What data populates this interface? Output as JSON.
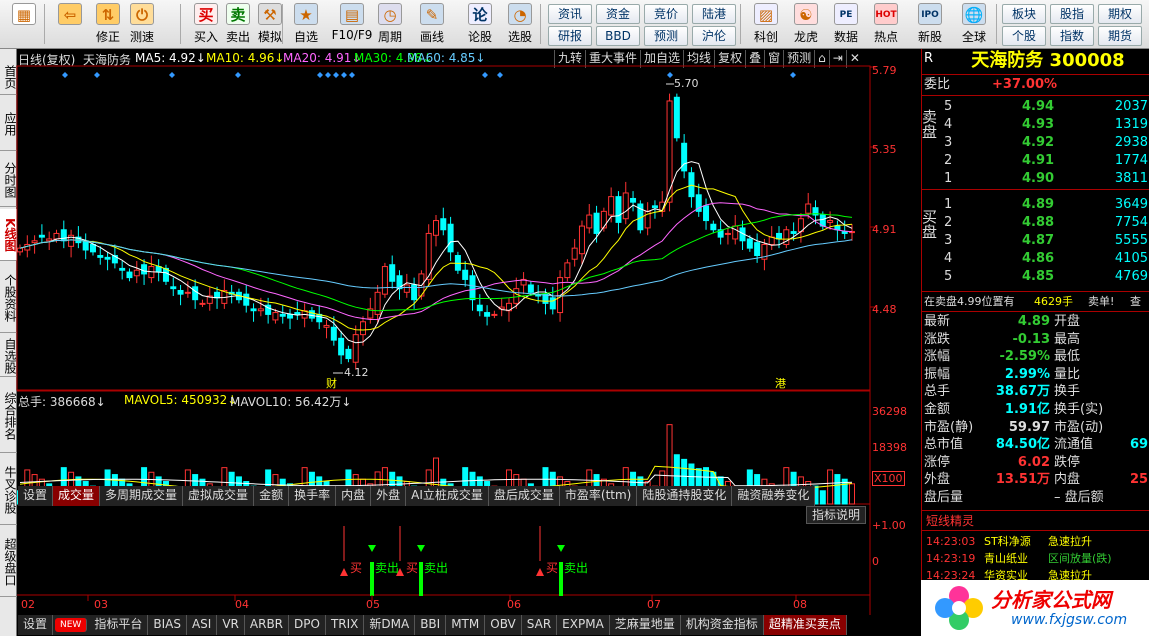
{
  "toolbar": {
    "buttons": [
      {
        "label": "",
        "icon": "windows-grid-icon"
      },
      {
        "label": "",
        "icon": "back-arrow-icon"
      },
      {
        "label": "修正",
        "icon": "up-down-arrows-icon"
      },
      {
        "label": "测速",
        "icon": "power-icon"
      },
      {
        "label": "买入",
        "icon": "buy-icon",
        "char": "买"
      },
      {
        "label": "卖出",
        "icon": "sell-icon",
        "char": "卖"
      },
      {
        "label": "模拟",
        "icon": "hammer-icon"
      },
      {
        "label": "自选",
        "icon": "star-icon"
      },
      {
        "label": "F10/F9",
        "icon": "f10-icon"
      },
      {
        "label": "周期",
        "icon": "cycle-icon"
      },
      {
        "label": "画线",
        "icon": "pencil-icon"
      },
      {
        "label": "论股",
        "icon": "discuss-icon",
        "char": "论"
      },
      {
        "label": "选股",
        "icon": "select-stock-icon"
      },
      {
        "label": "科创",
        "icon": "chart-small-icon"
      },
      {
        "label": "龙虎",
        "icon": "dragon-icon"
      },
      {
        "label": "数据",
        "icon": "pe-icon",
        "char": "PE"
      },
      {
        "label": "热点",
        "icon": "hot-icon",
        "char": "HOT"
      },
      {
        "label": "新股",
        "icon": "ipo-icon",
        "char": "IPO"
      },
      {
        "label": "全球",
        "icon": "globe-icon"
      }
    ],
    "small_buttons": [
      [
        "资讯",
        "资金",
        "竞价",
        "陆港"
      ],
      [
        "研报",
        "BBD",
        "预测",
        "沪伦"
      ]
    ],
    "right_buttons": [
      [
        "板块",
        "股指",
        "期权"
      ],
      [
        "个股",
        "指数",
        "期货"
      ]
    ]
  },
  "left_tabs": [
    "首页",
    "应用",
    "分时图",
    "K线图",
    "个股资料",
    "自选股",
    "综合排名",
    "牛叉诊股",
    "超级盘口"
  ],
  "chart": {
    "header": {
      "period": "日线(复权)",
      "name": "天海防务",
      "ma5": "MA5: 4.92↓",
      "ma10": "MA10: 4.96↓",
      "ma20": "MA20: 4.91↓",
      "ma30": "MA30: 4.98↓",
      "ma60": "MA60: 4.85↓"
    },
    "top_buttons": [
      "九转",
      "重大事件",
      "加自选",
      "均线",
      "复权",
      "叠",
      "窗",
      "预测",
      "⌂",
      "⇥",
      "✕"
    ],
    "price_labels": [
      "5.79",
      "5.35",
      "4.91",
      "4.48"
    ],
    "annotations": {
      "high": "5.70",
      "low": "4.12",
      "cai": "财",
      "gang": "港"
    },
    "volume_header": {
      "total": "总手: 386668↓",
      "mavol5": "MAVOL5: 450932↓",
      "mavol10": "MAVOL10: 56.42万↓"
    },
    "volume_labels": [
      "36298",
      "18398",
      "X100"
    ],
    "vol_tabs": [
      "设置",
      "成交量",
      "多周期成交量",
      "虚拟成交量",
      "金额",
      "换手率",
      "内盘",
      "外盘",
      "AI立桩成交量",
      "盘后成交量",
      "市盈率(ttm)",
      "陆股通持股变化",
      "融资融券变化"
    ],
    "indicator_button": "指标说明",
    "indicator_labels": [
      "+1.00",
      "0"
    ],
    "signals": {
      "buy": "买",
      "sell": "卖出"
    },
    "x_labels": [
      "02",
      "03",
      "04",
      "05",
      "06",
      "07",
      "08"
    ],
    "bottom_tabs": [
      "设置",
      "NEW",
      "指标平台",
      "BIAS",
      "ASI",
      "VR",
      "ARBR",
      "DPO",
      "TRIX",
      "新DMA",
      "BBI",
      "MTM",
      "OBV",
      "SAR",
      "EXPMA",
      "芝麻量地量",
      "机构资金指标",
      "超精准买卖点"
    ]
  },
  "colors": {
    "up": "#ff3333",
    "down": "#00ffff",
    "ma5": "#ffffff",
    "ma10": "#ffff00",
    "ma20": "#ff66ff",
    "ma30": "#00ff00",
    "ma60": "#66ccff"
  },
  "right_panel": {
    "top_char": "R",
    "stock_title": "天海防务 300008",
    "weibi_label": "委比",
    "weibi_value": "+37.00%",
    "sell_label": "卖盘",
    "buy_label": "买盘",
    "asks": [
      {
        "level": "5",
        "price": "4.94",
        "vol": "2037"
      },
      {
        "level": "4",
        "price": "4.93",
        "vol": "1319"
      },
      {
        "level": "3",
        "price": "4.92",
        "vol": "2938"
      },
      {
        "level": "2",
        "price": "4.91",
        "vol": "1774"
      },
      {
        "level": "1",
        "price": "4.90",
        "vol": "3811"
      }
    ],
    "bids": [
      {
        "level": "1",
        "price": "4.89",
        "vol": "3649"
      },
      {
        "level": "2",
        "price": "4.88",
        "vol": "7754"
      },
      {
        "level": "3",
        "price": "4.87",
        "vol": "5555"
      },
      {
        "level": "4",
        "price": "4.86",
        "vol": "4105"
      },
      {
        "level": "5",
        "price": "4.85",
        "vol": "4769"
      }
    ],
    "notice": "在卖盘4.99位置有",
    "notice_vol": "4629手",
    "notice_end": "卖单!",
    "notice_link": "查",
    "quote": [
      {
        "k1": "最新",
        "v1": "4.89",
        "k2": "开盘",
        "c": "green"
      },
      {
        "k1": "涨跌",
        "v1": "-0.13",
        "k2": "最高",
        "c": "green"
      },
      {
        "k1": "涨幅",
        "v1": "-2.59%",
        "k2": "最低",
        "c": "green"
      },
      {
        "k1": "振幅",
        "v1": "2.99%",
        "k2": "量比",
        "c": "cyan"
      },
      {
        "k1": "总手",
        "v1": "38.67万",
        "k2": "换手",
        "c": "cyan"
      },
      {
        "k1": "金额",
        "v1": "1.91亿",
        "k2": "换手(实)",
        "c": "cyan"
      },
      {
        "k1": "市盈(静)",
        "v1": "59.97",
        "k2": "市盈(动)",
        "c": "white"
      },
      {
        "k1": "总市值",
        "v1": "84.50亿",
        "k2": "流通值",
        "v2": "69",
        "c": "cyan"
      },
      {
        "k1": "涨停",
        "v1": "6.02",
        "k2": "跌停",
        "c": "red"
      },
      {
        "k1": "外盘",
        "v1": "13.51万",
        "k2": "内盘",
        "v2": "25",
        "c": "red"
      },
      {
        "k1": "盘后量",
        "v1": "",
        "k2": "– 盘后额",
        "c": "white"
      }
    ],
    "short_title": "短线精灵",
    "short_items": [
      {
        "time": "14:23:03",
        "name": "ST科净源",
        "event": "急速拉升"
      },
      {
        "time": "14:23:19",
        "name": "青山纸业",
        "event": "区间放量(跌)"
      },
      {
        "time": "14:23:24",
        "name": "华资实业",
        "event": "急速拉升"
      }
    ],
    "bottom_chars": [
      "国",
      "14"
    ],
    "logo_text": "分析家公式网",
    "logo_url": "www.fxjgsw.com"
  }
}
